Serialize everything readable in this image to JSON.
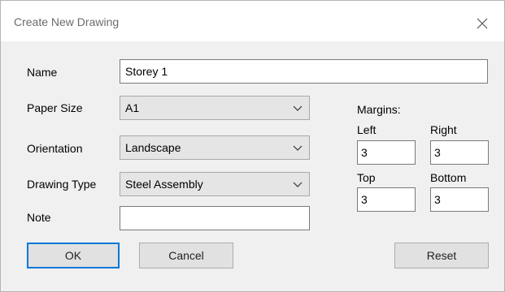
{
  "window": {
    "title": "Create New Drawing"
  },
  "form": {
    "name_label": "Name",
    "name_value": "Storey 1",
    "paper_size_label": "Paper Size",
    "paper_size_value": "A1",
    "orientation_label": "Orientation",
    "orientation_value": "Landscape",
    "drawing_type_label": "Drawing Type",
    "drawing_type_value": "Steel Assembly",
    "note_label": "Note",
    "note_value": ""
  },
  "margins": {
    "heading": "Margins:",
    "left_label": "Left",
    "left_value": "3",
    "right_label": "Right",
    "right_value": "3",
    "top_label": "Top",
    "top_value": "3",
    "bottom_label": "Bottom",
    "bottom_value": "3"
  },
  "buttons": {
    "ok": "OK",
    "cancel": "Cancel",
    "reset": "Reset"
  },
  "icons": {
    "close": "close-icon",
    "dropdown": "chevron-down-icon"
  },
  "colors": {
    "default_button_border": "#0078d7",
    "title_text": "#6b6b6b"
  }
}
